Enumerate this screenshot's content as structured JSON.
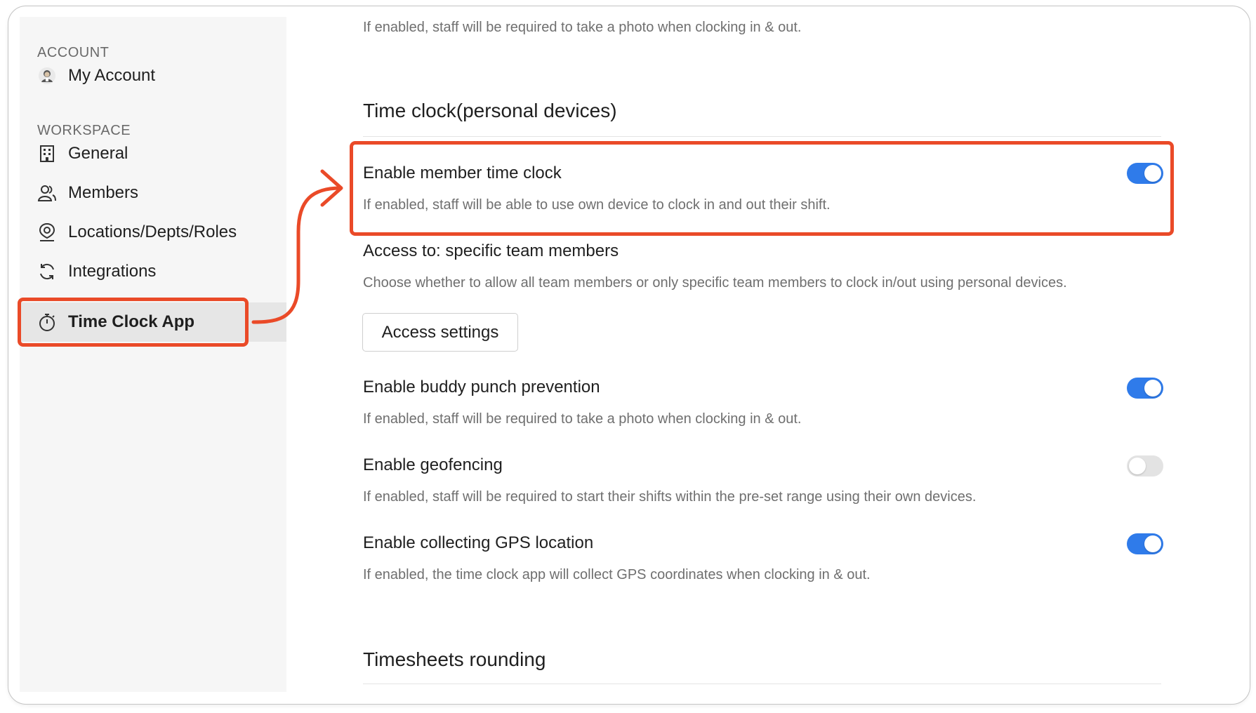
{
  "sidebar": {
    "sections": [
      {
        "title": "ACCOUNT"
      },
      {
        "title": "WORKSPACE"
      }
    ],
    "items": [
      {
        "label": "My Account",
        "icon": "avatar-icon"
      },
      {
        "label": "General",
        "icon": "building-icon"
      },
      {
        "label": "Members",
        "icon": "members-icon"
      },
      {
        "label": "Locations/Depts/Roles",
        "icon": "location-pin-icon"
      },
      {
        "label": "Integrations",
        "icon": "sync-icon"
      },
      {
        "label": "Time Clock App",
        "icon": "stopwatch-icon",
        "active": true
      }
    ]
  },
  "main": {
    "top_desc": "If enabled, staff will be required to take a photo when clocking in & out.",
    "section_title": "Time clock(personal devices)",
    "settings": [
      {
        "label": "Enable member time clock",
        "desc": "If enabled, staff will be able to use own device to clock in and out their shift.",
        "enabled": true
      },
      {
        "label": "Enable buddy punch prevention",
        "desc": "If enabled, staff will be required to take a photo when clocking in & out.",
        "enabled": true
      },
      {
        "label": "Enable geofencing",
        "desc": "If enabled, staff will be required to start their shifts within the pre-set range using their own devices.",
        "enabled": false
      },
      {
        "label": "Enable collecting GPS location",
        "desc": "If enabled, the time clock app will collect GPS coordinates when clocking in & out.",
        "enabled": true
      }
    ],
    "access": {
      "label": "Access to: specific team members",
      "desc": "Choose whether to allow all team members or only specific team members to clock in/out using personal devices.",
      "button": "Access settings"
    },
    "next_section_title": "Timesheets rounding"
  },
  "colors": {
    "accent": "#2f7bea",
    "highlight": "#ea4a28",
    "toggle_off": "#e3e3e3"
  }
}
